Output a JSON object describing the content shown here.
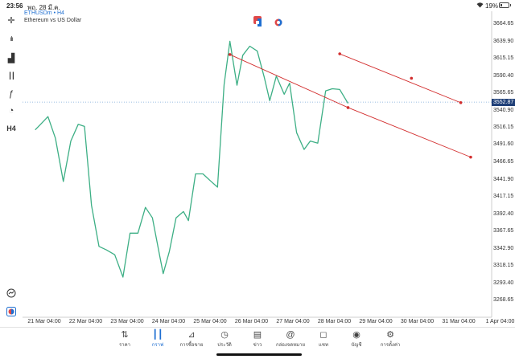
{
  "status_bar": {
    "time": "23:56",
    "date": "พฤ. 28 มี.ค.",
    "battery": "19%"
  },
  "symbol": {
    "name": "ETHUSDm",
    "timeframe_sep": "•",
    "timeframe": "H4",
    "description": "Ethereum vs US Dollar"
  },
  "toolbar": [
    {
      "name": "crosshair-icon",
      "glyph": "✛"
    },
    {
      "name": "indicators-icon",
      "glyph": "ılı"
    },
    {
      "name": "chart-type-icon",
      "glyph": "▟"
    },
    {
      "name": "candles-icon",
      "glyph": "┃┃"
    },
    {
      "name": "function-icon",
      "glyph": "ƒ"
    },
    {
      "name": "objects-icon",
      "glyph": "◔"
    },
    {
      "name": "timeframe-button",
      "glyph": "H4"
    }
  ],
  "current_price": "3552.87",
  "chart_data": {
    "type": "line",
    "title": "ETHUSDm, H4",
    "x": [
      "21 Mar 04:00",
      "22 Mar 04:00",
      "23 Mar 04:00",
      "24 Mar 04:00",
      "25 Mar 04:00",
      "26 Mar 04:00",
      "27 Mar 04:00",
      "28 Mar 04:00",
      "29 Mar 04:00",
      "30 Mar 04:00",
      "31 Mar 04:00",
      "1 Apr 04:00"
    ],
    "y_ticks": [
      "3664.65",
      "3639.90",
      "3615.15",
      "3590.40",
      "3565.65",
      "3540.90",
      "3516.15",
      "3491.60",
      "3466.65",
      "3441.90",
      "3417.15",
      "3392.40",
      "3367.65",
      "3342.90",
      "3318.15",
      "3293.40",
      "3268.65"
    ],
    "ylim": [
      3250,
      3680
    ],
    "series": [
      {
        "color": "#3daf85",
        "values": [
          {
            "x": -0.22,
            "y": 3513
          },
          {
            "x": -0.09,
            "y": 3521
          },
          {
            "x": 0.09,
            "y": 3532
          },
          {
            "x": 0.27,
            "y": 3501
          },
          {
            "x": 0.46,
            "y": 3439
          },
          {
            "x": 0.64,
            "y": 3497
          },
          {
            "x": 0.82,
            "y": 3521
          },
          {
            "x": 0.97,
            "y": 3518
          },
          {
            "x": 1.14,
            "y": 3405
          },
          {
            "x": 1.32,
            "y": 3346
          },
          {
            "x": 1.5,
            "y": 3341
          },
          {
            "x": 1.7,
            "y": 3334
          },
          {
            "x": 1.9,
            "y": 3302
          },
          {
            "x": 2.07,
            "y": 3365
          },
          {
            "x": 2.26,
            "y": 3365
          },
          {
            "x": 2.44,
            "y": 3402
          },
          {
            "x": 2.61,
            "y": 3387
          },
          {
            "x": 2.79,
            "y": 3331
          },
          {
            "x": 2.87,
            "y": 3307
          },
          {
            "x": 3.02,
            "y": 3339
          },
          {
            "x": 3.18,
            "y": 3387
          },
          {
            "x": 3.36,
            "y": 3396
          },
          {
            "x": 3.48,
            "y": 3383
          },
          {
            "x": 3.65,
            "y": 3450
          },
          {
            "x": 3.83,
            "y": 3450
          },
          {
            "x": 4.01,
            "y": 3440
          },
          {
            "x": 4.18,
            "y": 3431
          },
          {
            "x": 4.34,
            "y": 3578
          },
          {
            "x": 4.48,
            "y": 3640
          },
          {
            "x": 4.65,
            "y": 3577
          },
          {
            "x": 4.79,
            "y": 3620
          },
          {
            "x": 4.96,
            "y": 3633
          },
          {
            "x": 5.14,
            "y": 3626
          },
          {
            "x": 5.31,
            "y": 3588
          },
          {
            "x": 5.44,
            "y": 3555
          },
          {
            "x": 5.6,
            "y": 3590
          },
          {
            "x": 5.79,
            "y": 3564
          },
          {
            "x": 5.92,
            "y": 3580
          },
          {
            "x": 6.09,
            "y": 3509
          },
          {
            "x": 6.27,
            "y": 3485
          },
          {
            "x": 6.42,
            "y": 3497
          },
          {
            "x": 6.6,
            "y": 3494
          },
          {
            "x": 6.79,
            "y": 3569
          },
          {
            "x": 6.95,
            "y": 3572
          },
          {
            "x": 7.13,
            "y": 3571
          },
          {
            "x": 7.33,
            "y": 3551
          }
        ]
      }
    ],
    "trendlines": [
      {
        "color": "#d32f2f",
        "x1": 4.48,
        "y1": 3621,
        "x2": 7.33,
        "y2": 3545
      },
      {
        "color": "#d32f2f",
        "x1": 7.13,
        "y1": 3622,
        "x2": 10.05,
        "y2": 3552
      },
      {
        "color": "#d32f2f",
        "x1": 10.29,
        "y1": 3474,
        "x2": 10.29,
        "y2": 3474,
        "note_style": "point"
      }
    ],
    "current_price_line": 3552.87
  },
  "bottom_nav": [
    {
      "name": "nav-quotes",
      "label": "ราคา",
      "icon": "⇅",
      "active": false
    },
    {
      "name": "nav-chart",
      "label": "กราฟ",
      "icon": "┃┃",
      "active": true
    },
    {
      "name": "nav-trade",
      "label": "การซื้อขาย",
      "icon": "📈",
      "active": false
    },
    {
      "name": "nav-history",
      "label": "ประวัติ",
      "icon": "◷",
      "active": false
    },
    {
      "name": "nav-news",
      "label": "ข่าว",
      "icon": "▤",
      "active": false
    },
    {
      "name": "nav-mailbox",
      "label": "กล่องจดหมาย",
      "icon": "@",
      "active": false
    },
    {
      "name": "nav-chat",
      "label": "แชท",
      "icon": "◻",
      "active": false
    },
    {
      "name": "nav-accounts",
      "label": "บัญชี",
      "icon": "◉",
      "active": false
    },
    {
      "name": "nav-settings",
      "label": "การตั้งค่า",
      "icon": "⚙",
      "active": false
    }
  ]
}
